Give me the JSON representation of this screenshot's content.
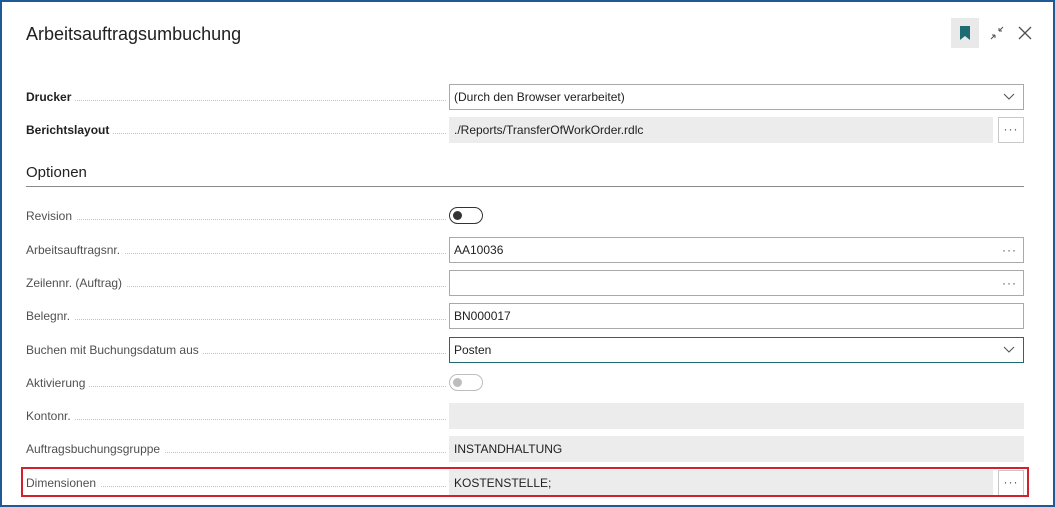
{
  "window": {
    "title": "Arbeitsauftragsumbuchung",
    "icons": [
      "bookmark-icon",
      "collapse-icon",
      "close-icon"
    ]
  },
  "report": {
    "printer_label": "Drucker",
    "printer_value": "(Durch den Browser verarbeitet)",
    "layout_label": "Berichtslayout",
    "layout_value": "./Reports/TransferOfWorkOrder.rdlc"
  },
  "options": {
    "section_title": "Optionen",
    "revision_label": "Revision",
    "revision_on": false,
    "work_order_label": "Arbeitsauftragsnr.",
    "work_order_value": "AA10036",
    "line_no_label": "Zeilennr. (Auftrag)",
    "line_no_value": "",
    "doc_no_label": "Belegnr.",
    "doc_no_value": "BN000017",
    "posting_date_label": "Buchen mit Buchungsdatum aus",
    "posting_date_value": "Posten",
    "activation_label": "Aktivierung",
    "activation_on": false,
    "account_label": "Kontonr.",
    "account_value": "",
    "posting_group_label": "Auftragsbuchungsgruppe",
    "posting_group_value": "INSTANDHALTUNG",
    "dimensions_label": "Dimensionen",
    "dimensions_value": "KOSTENSTELLE;"
  },
  "ellipsis": "···",
  "colors": {
    "frame_border": "#1f5a96",
    "accent": "#1e6b72",
    "highlight": "#d2202f"
  }
}
